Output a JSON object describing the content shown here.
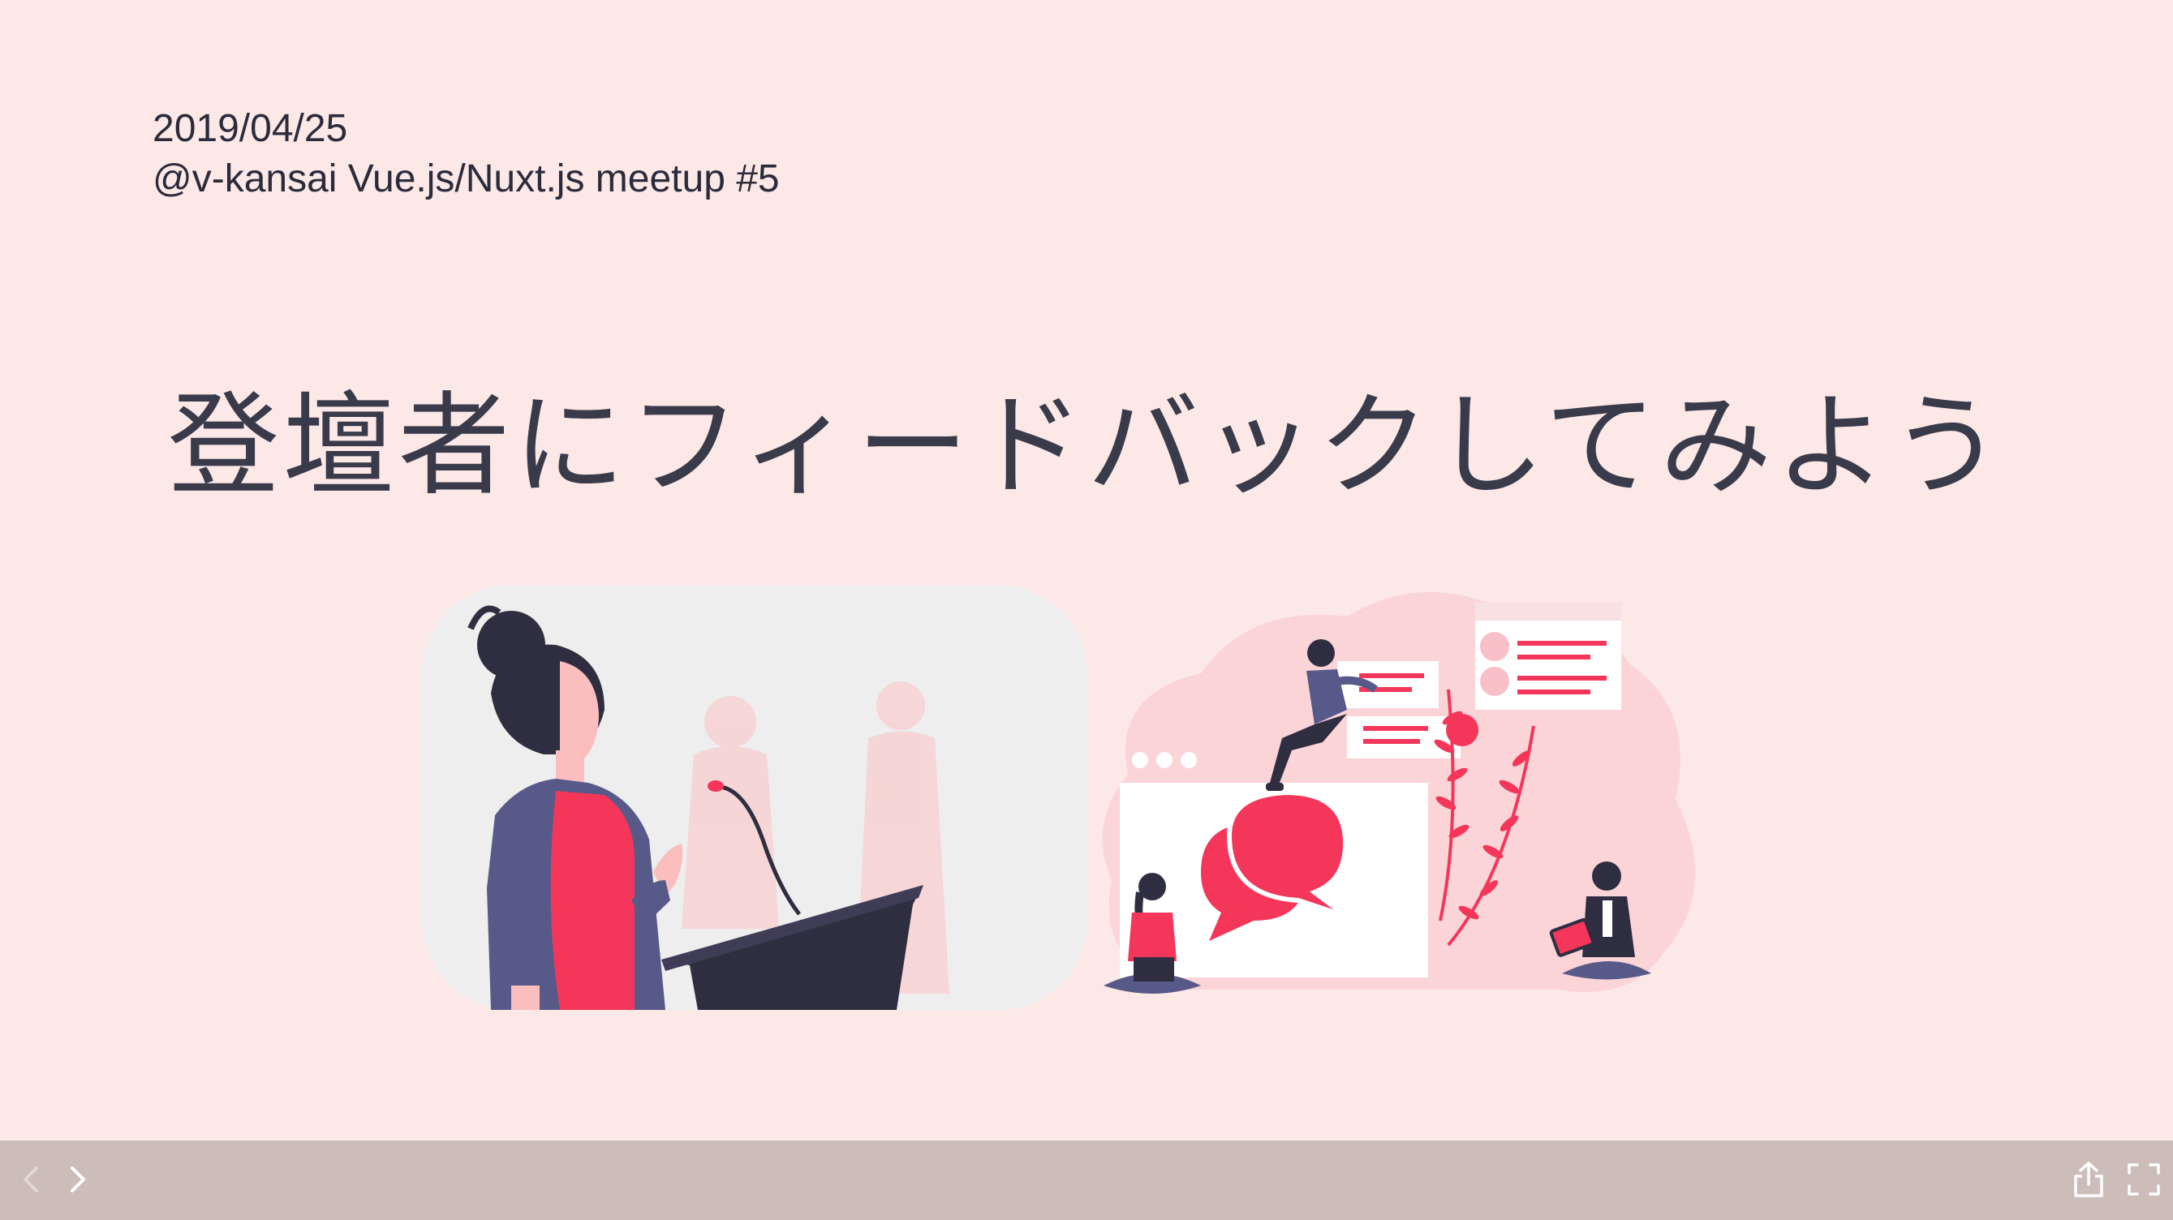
{
  "slide": {
    "date": "2019/04/25",
    "event": "@v-kansai Vue.js/Nuxt.js meetup #5",
    "title": "登壇者にフィードバックしてみよう"
  },
  "illustrations": {
    "left": "speaker-at-podium-illustration",
    "right": "feedback-chat-illustration"
  },
  "toolbar": {
    "icons": {
      "prev": "chevron-left-icon",
      "next": "chevron-right-icon",
      "share": "share-icon",
      "fullscreen": "fullscreen-icon"
    }
  },
  "colors": {
    "background": "#fde8e8",
    "accent": "#f4365a",
    "dark": "#3f3d56",
    "toolbar": "#cdbdb8"
  }
}
